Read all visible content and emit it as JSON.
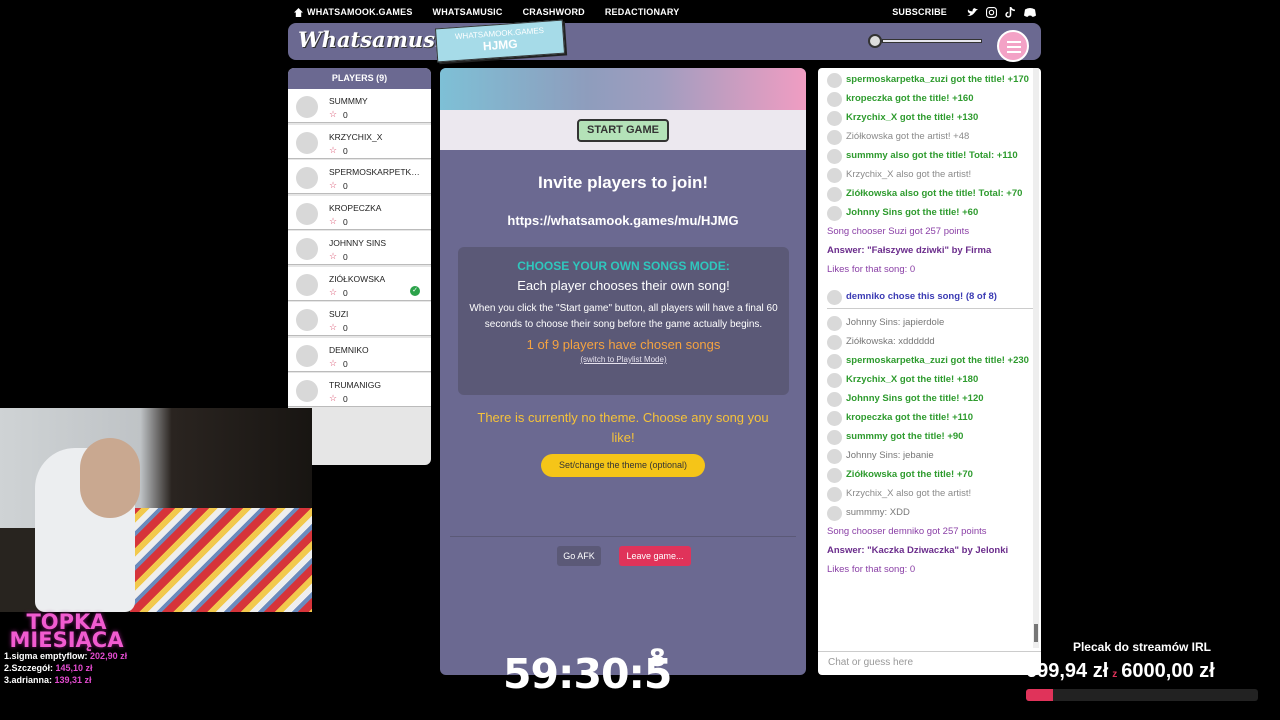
{
  "nav": {
    "home": "WHATSAMOOK.GAMES",
    "links": [
      "WHATSAMUSIC",
      "CRASHWORD",
      "REDACTIONARY"
    ],
    "subscribe": "SUBSCRIBE"
  },
  "header": {
    "logo": "Whatsamusic",
    "game_site": "WHATSAMOOK.GAMES",
    "game_code": "HJMG"
  },
  "players": {
    "title": "PLAYERS (9)",
    "list": [
      {
        "name": "SUMMMY",
        "score": "0",
        "chose": false
      },
      {
        "name": "KRZYCHIX_X",
        "score": "0",
        "chose": false
      },
      {
        "name": "SPERMOSKARPETKA_ZUZI",
        "score": "0",
        "chose": false
      },
      {
        "name": "KROPECZKA",
        "score": "0",
        "chose": false
      },
      {
        "name": "JOHNNY SINS",
        "score": "0",
        "chose": false
      },
      {
        "name": "ZIÓŁKOWSKA",
        "score": "0",
        "chose": true
      },
      {
        "name": "SUZI",
        "score": "0",
        "chose": false
      },
      {
        "name": "DEMNIKO",
        "score": "0",
        "chose": false
      },
      {
        "name": "TRUMANIGG",
        "score": "0",
        "chose": false
      }
    ]
  },
  "center": {
    "start_label": "START GAME",
    "invite": "Invite players to join!",
    "url": "https://whatsamook.games/mu/HJMG",
    "mode_title": "CHOOSE YOUR OWN SONGS MODE:",
    "mode_sub": "Each player chooses their own song!",
    "mode_desc": "When you click the \"Start game\" button, all players will have a final 60 seconds to choose their song before the game actually begins.",
    "chosen": "1 of 9 players have chosen songs",
    "switch": "(switch to Playlist Mode)",
    "theme": "There is currently no theme. Choose any song you like!",
    "theme_btn": "Set/change the theme (optional)",
    "afk": "Go AFK",
    "leave": "Leave game..."
  },
  "chat": {
    "messages": [
      {
        "text": "spermoskarpetka_zuzi got the title! +170",
        "type": "title"
      },
      {
        "text": "kropeczka got the title! +160",
        "type": "title"
      },
      {
        "text": "Krzychix_X got the title! +130",
        "type": "title"
      },
      {
        "text": "Ziółkowska got the artist! +48",
        "type": "artist"
      },
      {
        "text": "summmy also got the title! Total: +110",
        "type": "title"
      },
      {
        "text": "Krzychix_X also got the artist!",
        "type": "artist"
      },
      {
        "text": "Ziółkowska also got the title! Total: +70",
        "type": "title"
      },
      {
        "text": "Johnny Sins got the title! +60",
        "type": "title"
      },
      {
        "text": "Song chooser Suzi got 257 points",
        "type": "purple"
      },
      {
        "text": "Answer: \"Fałszywe dziwki\" by Firma",
        "type": "answer"
      },
      {
        "text": "Likes for that song: 0",
        "type": "purple"
      },
      {
        "text": "demniko chose this song! (8 of 8)",
        "type": "chose"
      },
      {
        "text": "Johnny Sins: japierdole",
        "type": "plain"
      },
      {
        "text": "Ziółkowska: xdddddd",
        "type": "plain"
      },
      {
        "text": "spermoskarpetka_zuzi got the title! +230",
        "type": "title"
      },
      {
        "text": "Krzychix_X got the title! +180",
        "type": "title"
      },
      {
        "text": "Johnny Sins got the title! +120",
        "type": "title"
      },
      {
        "text": "kropeczka got the title! +110",
        "type": "title"
      },
      {
        "text": "summmy got the title! +90",
        "type": "title"
      },
      {
        "text": "Johnny Sins: jebanie",
        "type": "plain"
      },
      {
        "text": "Ziółkowska got the title! +70",
        "type": "title"
      },
      {
        "text": "Krzychix_X also got the artist!",
        "type": "artist"
      },
      {
        "text": "summmy: XDD",
        "type": "plain"
      },
      {
        "text": "Song chooser demniko got 257 points",
        "type": "purple"
      },
      {
        "text": "Answer: \"Kaczka Dziwaczka\" by Jelonki",
        "type": "answer"
      },
      {
        "text": "Likes for that song: 0",
        "type": "purple"
      }
    ],
    "placeholder": "Chat or guess here"
  },
  "stream": {
    "timer": "59:30:5",
    "timer_sup": "8",
    "topka_title": "TOPKA MIESIĄCA",
    "topka": [
      {
        "rank": "1.sigma emptyflow:",
        "amount": "202,90 zł"
      },
      {
        "rank": "2.Szczegół:",
        "amount": "145,10 zł"
      },
      {
        "rank": "3.adrianna:",
        "amount": "139,31 zł"
      }
    ],
    "donation_title": "Plecak do streamów IRL",
    "donation_current": "699,94 zł",
    "donation_sep": "z",
    "donation_goal": "6000,00 zł",
    "donation_progress": 0.117
  }
}
